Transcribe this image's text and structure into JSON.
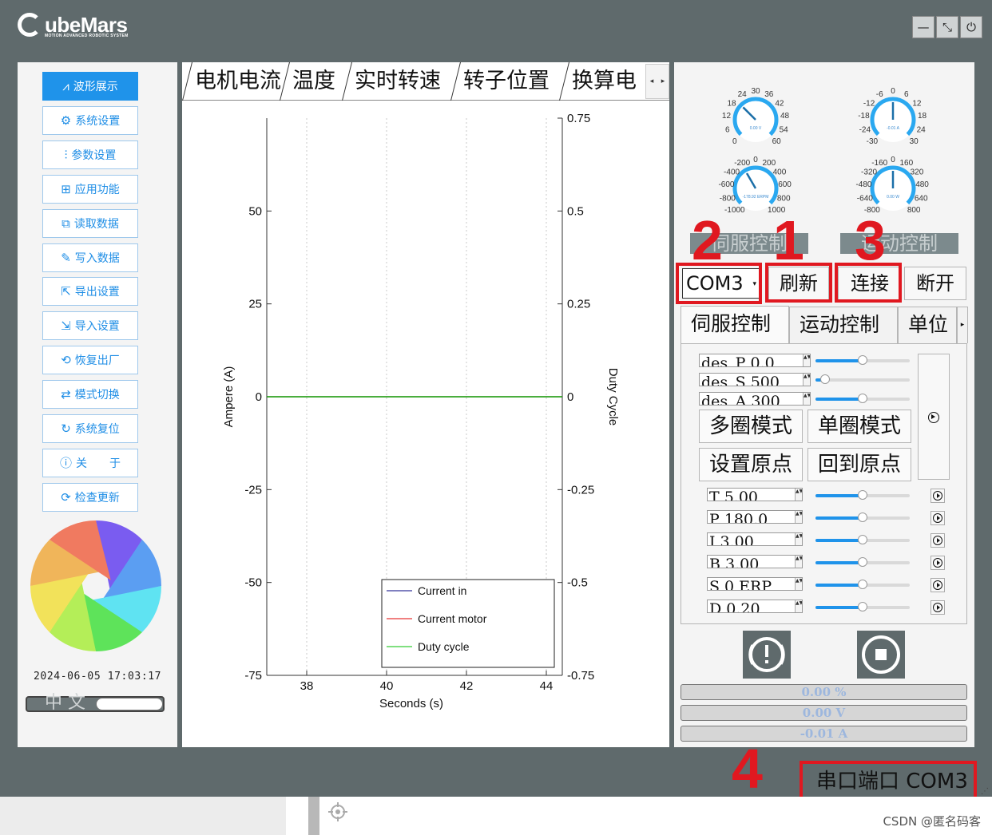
{
  "app": {
    "logo_text": "ubeMars",
    "logo_sub": "MOTION ADVANCED ROBOTIC SYSTEM",
    "window_buttons": [
      "—",
      "⤡",
      "⏻"
    ]
  },
  "sidebar": {
    "items": [
      {
        "label": "波形展示",
        "icon": "waveform-icon",
        "glyph": "⩘"
      },
      {
        "label": "系统设置",
        "icon": "gear-icon",
        "glyph": "⚙"
      },
      {
        "label": "参数设置",
        "icon": "sliders-icon",
        "glyph": "⫶"
      },
      {
        "label": "应用功能",
        "icon": "grid-icon",
        "glyph": "⊞"
      },
      {
        "label": "读取数据",
        "icon": "read-data-icon",
        "glyph": "⧉"
      },
      {
        "label": "写入数据",
        "icon": "write-data-icon",
        "glyph": "✎"
      },
      {
        "label": "导出设置",
        "icon": "export-icon",
        "glyph": "⇱"
      },
      {
        "label": "导入设置",
        "icon": "import-icon",
        "glyph": "⇲"
      },
      {
        "label": "恢复出厂",
        "icon": "restore-icon",
        "glyph": "⟲"
      },
      {
        "label": "模式切换",
        "icon": "switch-icon",
        "glyph": "⇄"
      },
      {
        "label": "系统复位",
        "icon": "reset-icon",
        "glyph": "↻"
      },
      {
        "label": "关　　于",
        "icon": "info-icon",
        "glyph": "ⓘ"
      },
      {
        "label": "检查更新",
        "icon": "update-icon",
        "glyph": "⟳"
      }
    ],
    "clock": "2024-06-05  17:03:17",
    "language": "中 文",
    "aperture_colors": [
      "#7a5cf0",
      "#5b9ef2",
      "#5fe3f2",
      "#5ee35a",
      "#b4ee58",
      "#f2e25a",
      "#f0b55a",
      "#f07a60"
    ]
  },
  "tabs": {
    "items": [
      "电机电流",
      "温度",
      "实时转速",
      "转子位置",
      "换算电"
    ],
    "scroll_left": "◂",
    "scroll_right": "▸"
  },
  "chart_data": {
    "type": "line",
    "xlabel": "Seconds (s)",
    "ylabel": "Ampere (A)",
    "y2label": "Duty Cycle",
    "xlim": [
      37,
      44.4
    ],
    "xticks": [
      38,
      40,
      42,
      44
    ],
    "ylim": [
      -75,
      75
    ],
    "yticks": [
      50,
      25,
      0,
      -25,
      -50,
      -75
    ],
    "y2lim": [
      -0.75,
      0.75
    ],
    "y2ticks": [
      0.75,
      0.5,
      0.25,
      0,
      -0.25,
      -0.5,
      -0.75
    ],
    "grid": true,
    "legend_position": "bottom-right",
    "series": [
      {
        "name": "Current in",
        "color": "#000080",
        "x": [
          37,
          44.4
        ],
        "y": [
          0,
          0
        ]
      },
      {
        "name": "Current motor",
        "color": "#e00000",
        "x": [
          37,
          44.4
        ],
        "y": [
          0,
          0
        ]
      },
      {
        "name": "Duty cycle",
        "color": "#00c000",
        "x": [
          37,
          44.4
        ],
        "y": [
          0,
          0
        ]
      }
    ]
  },
  "gauges": [
    {
      "ticks": [
        "0",
        "6",
        "12",
        "18",
        "24",
        "30",
        "36",
        "42",
        "48",
        "54",
        "60"
      ],
      "value": "0.00 V",
      "color": "#2aa8f0"
    },
    {
      "ticks": [
        "-30",
        "-24",
        "-18",
        "-12",
        "-6",
        "0",
        "6",
        "12",
        "18",
        "24",
        "30"
      ],
      "value": "-0.01 A",
      "color": "#2aa8f0"
    },
    {
      "ticks": [
        "-1000",
        "-800",
        "-600",
        "-400",
        "-200",
        "0",
        "200",
        "400",
        "600",
        "800",
        "1000"
      ],
      "value": "-178.92 ERPM",
      "color": "#2aa8f0"
    },
    {
      "ticks": [
        "-800",
        "-640",
        "-480",
        "-320",
        "-160",
        "0",
        "160",
        "320",
        "480",
        "640",
        "800"
      ],
      "value": "0.00 W",
      "color": "#2aa8f0"
    }
  ],
  "control": {
    "section_servo": "伺服控制",
    "section_motion": "运动控制",
    "port_value": "COM3",
    "refresh": "刷新",
    "connect": "连接",
    "disconnect": "断开",
    "subtabs": [
      "伺服控制",
      "运动控制",
      "单位"
    ],
    "des_fields": [
      "des_P 0.0",
      "des_S 500",
      "des_A 300"
    ],
    "des_slider_values": [
      0.5,
      0.1,
      0.5
    ],
    "mode_buttons": [
      "多圈模式",
      "单圈模式",
      "设置原点",
      "回到原点"
    ],
    "params": [
      {
        "text": "T 5.00",
        "value": 0.5
      },
      {
        "text": "P 180.0",
        "value": 0.5
      },
      {
        "text": "I 3.00",
        "value": 0.5
      },
      {
        "text": "B 3.00",
        "value": 0.5
      },
      {
        "text": "S 0 ERP",
        "value": 0.5
      },
      {
        "text": "D 0.20",
        "value": 0.5
      }
    ],
    "readouts": [
      "0.00 %",
      "0.00 V",
      "-0.01 A"
    ]
  },
  "annotations": [
    "1",
    "2",
    "3",
    "4"
  ],
  "status": {
    "port_text": "串口端口 COM3"
  },
  "watermark": "CSDN @匿名码客"
}
